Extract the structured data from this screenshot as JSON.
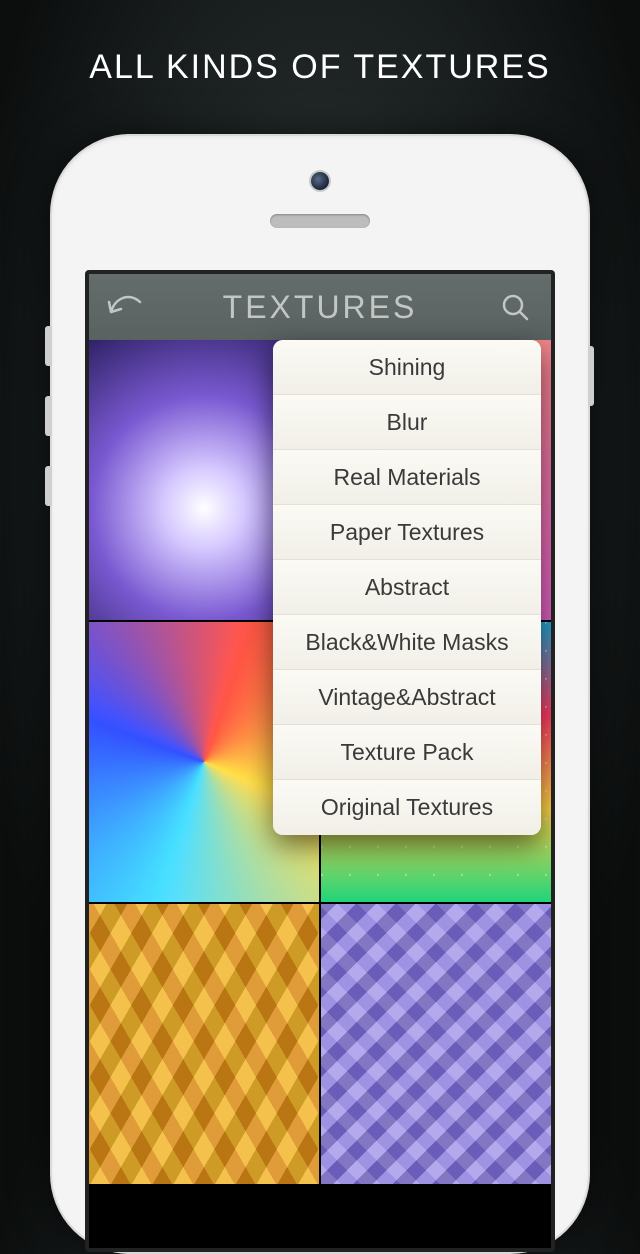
{
  "marketing": {
    "headline": "ALL KINDS OF TEXTURES"
  },
  "app": {
    "header_title": "TEXTURES"
  },
  "popover": {
    "items": [
      "Shining",
      "Blur",
      "Real Materials",
      "Paper Textures",
      "Abstract",
      "Black&White Masks",
      "Vintage&Abstract",
      "Texture Pack",
      "Original Textures"
    ]
  }
}
